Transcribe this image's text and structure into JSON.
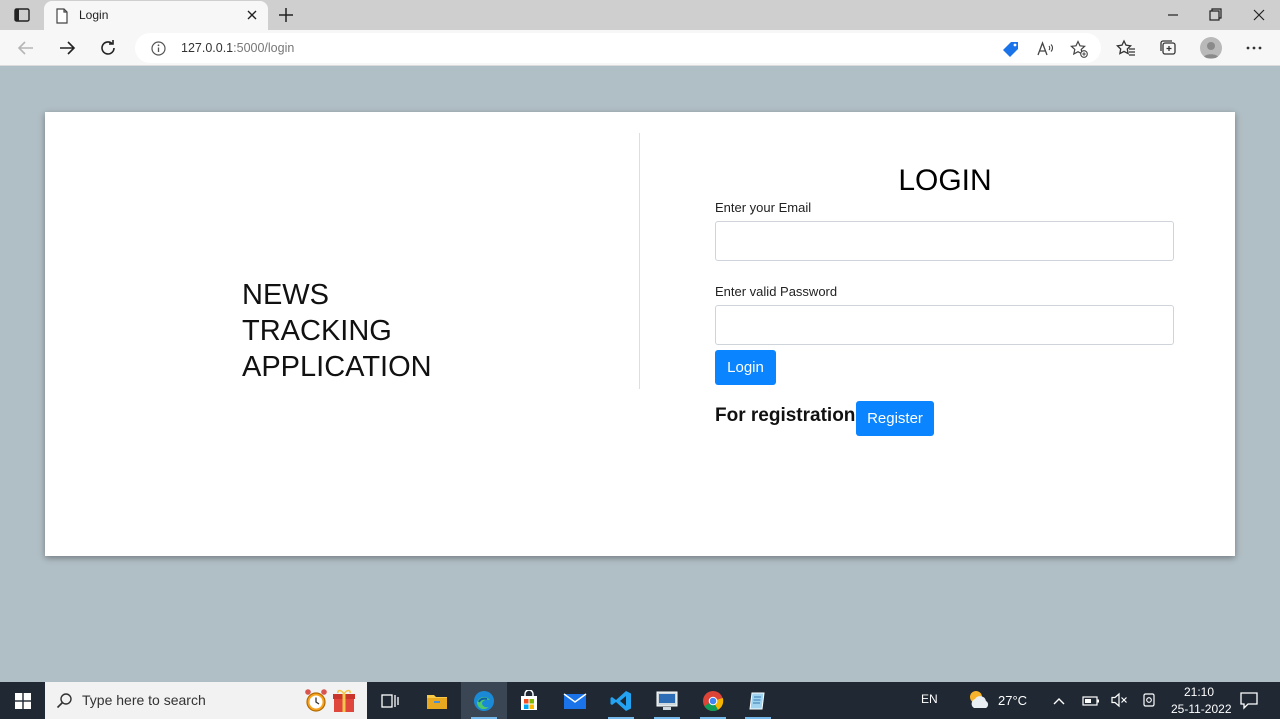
{
  "browser": {
    "tab_title": "Login",
    "url_host": "127.0.0.1",
    "url_rest": ":5000/login"
  },
  "page": {
    "brand_lines": [
      "NEWS",
      "TRACKING",
      "APPLICATION"
    ],
    "login_heading": "LOGIN",
    "email_label": "Enter your Email",
    "email_value": "",
    "password_label": "Enter valid Password",
    "password_value": "",
    "login_button": "Login",
    "registration_text": "For registration",
    "register_button": "Register"
  },
  "taskbar": {
    "search_placeholder": "Type here to search",
    "language": "EN",
    "temperature": "27°C",
    "time": "21:10",
    "date": "25-11-2022"
  },
  "colors": {
    "page_background": "#b0bec5",
    "button_blue": "#0a84ff",
    "taskbar": "#1f2833"
  }
}
